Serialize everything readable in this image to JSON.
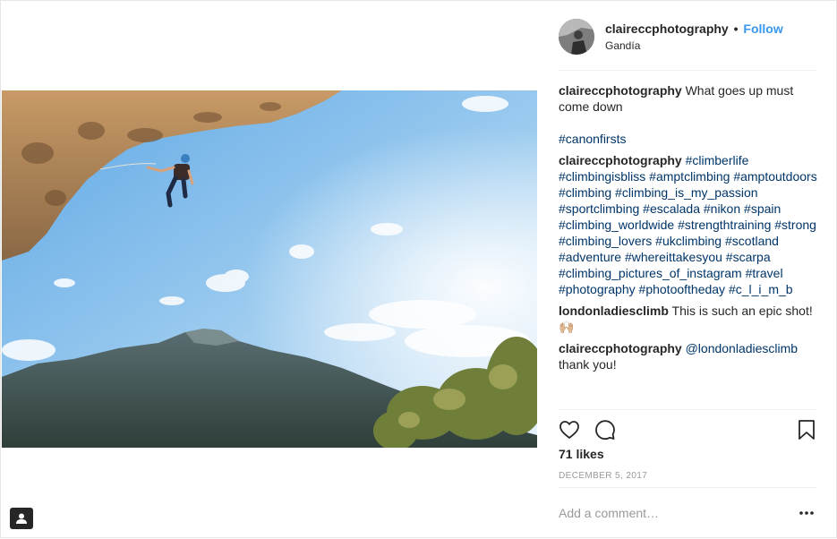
{
  "post": {
    "username": "claireccphotography",
    "location": "Gandía",
    "follow_label": "Follow",
    "header_separator": "•"
  },
  "caption": {
    "username": "claireccphotography",
    "text": "What goes up must come down",
    "hashtag": "#canonfirsts"
  },
  "comments": [
    {
      "username": "claireccphotography",
      "hashtags": [
        "#climberlife",
        "#climbingisbliss",
        "#amptclimbing",
        "#amptoutdoors",
        "#climbing",
        "#climbing_is_my_passion",
        "#sportclimbing",
        "#escalada",
        "#nikon",
        "#spain",
        "#climbing_worldwide",
        "#strengthtraining",
        "#strong",
        "#climbing_lovers",
        "#ukclimbing",
        "#scotland",
        "#adventure",
        "#whereittakesyou",
        "#scarpa",
        "#climbing_pictures_of_instagram",
        "#travel",
        "#photography",
        "#photooftheday",
        "#c_l_i_m_b"
      ]
    },
    {
      "username": "londonladiesclimb",
      "text": "This is such an epic shot! 🙌🏼"
    },
    {
      "username": "claireccphotography",
      "mention": "@londonladiesclimb",
      "text": "thank you!"
    }
  ],
  "stats": {
    "likes": "71 likes",
    "date": "DECEMBER 5, 2017"
  },
  "comment_input": {
    "placeholder": "Add a comment…"
  },
  "icons": {
    "like": "heart-icon",
    "comment": "comment-bubble-icon",
    "save": "bookmark-icon",
    "more": "more-options-icon",
    "tag": "user-tag-icon"
  },
  "colors": {
    "accent": "#3897f0",
    "hashtag": "#003569",
    "text": "#262626",
    "muted": "#999999"
  }
}
